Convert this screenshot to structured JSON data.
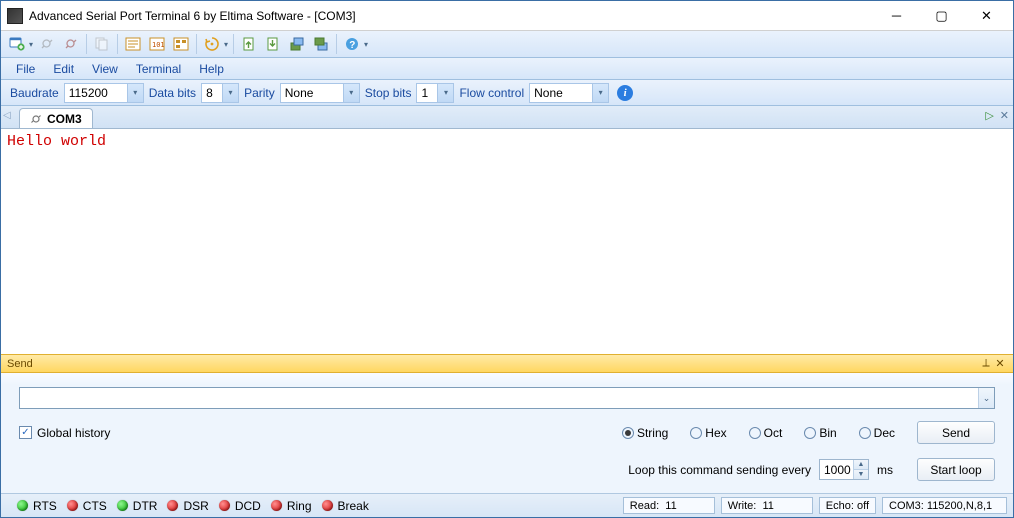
{
  "window": {
    "title": "Advanced Serial Port Terminal 6 by Eltima Software - [COM3]"
  },
  "menu": {
    "file": "File",
    "edit": "Edit",
    "view": "View",
    "terminal": "Terminal",
    "help": "Help"
  },
  "config": {
    "baudrate_label": "Baudrate",
    "baudrate": "115200",
    "databits_label": "Data bits",
    "databits": "8",
    "parity_label": "Parity",
    "parity": "None",
    "stopbits_label": "Stop bits",
    "stopbits": "1",
    "flow_label": "Flow control",
    "flow": "None"
  },
  "tab": {
    "name": "COM3"
  },
  "terminal": {
    "content": "Hello world"
  },
  "send": {
    "header": "Send",
    "global_history": "Global history",
    "modes": {
      "string": "String",
      "hex": "Hex",
      "oct": "Oct",
      "bin": "Bin",
      "dec": "Dec"
    },
    "active_mode": "string",
    "send_btn": "Send",
    "loop_label": "Loop this command sending every",
    "loop_value": "1000",
    "loop_unit": "ms",
    "loop_btn": "Start loop"
  },
  "status": {
    "signals": [
      {
        "name": "RTS",
        "on": true
      },
      {
        "name": "CTS",
        "on": false
      },
      {
        "name": "DTR",
        "on": true
      },
      {
        "name": "DSR",
        "on": false
      },
      {
        "name": "DCD",
        "on": false
      },
      {
        "name": "Ring",
        "on": false
      },
      {
        "name": "Break",
        "on": false
      }
    ],
    "read_label": "Read:",
    "read": "11",
    "write_label": "Write:",
    "write": "11",
    "echo": "Echo: off",
    "port": "COM3: 115200,N,8,1"
  }
}
